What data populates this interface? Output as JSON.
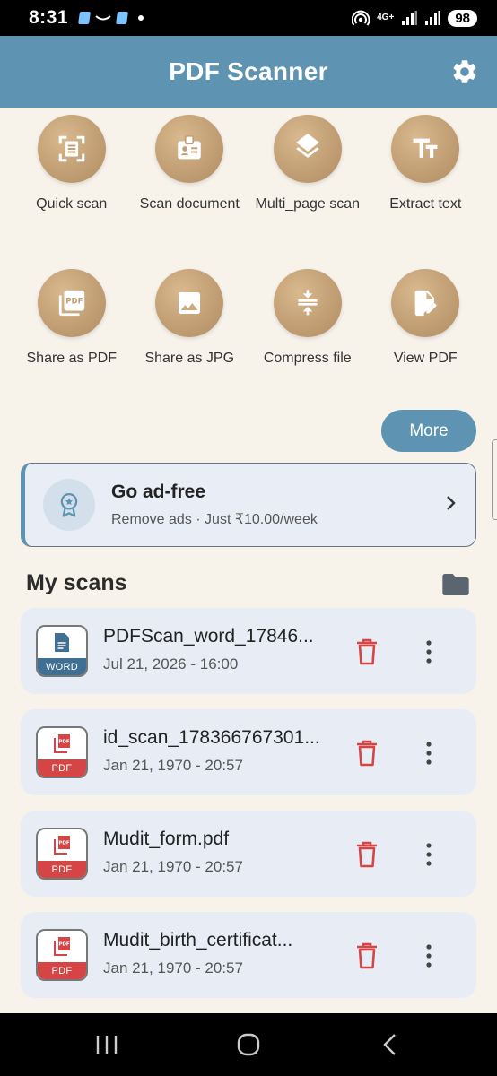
{
  "status_bar": {
    "time": "8:31",
    "network": "4G+",
    "battery": "98"
  },
  "app_bar": {
    "title": "PDF Scanner",
    "settings_icon": "gear-icon"
  },
  "tools": [
    {
      "label": "Quick scan",
      "icon": "scan-frame-icon"
    },
    {
      "label": "Scan document",
      "icon": "id-card-icon"
    },
    {
      "label": "Multi_page scan",
      "icon": "layers-icon"
    },
    {
      "label": "Extract text",
      "icon": "text-size-icon"
    },
    {
      "label": "Share as PDF",
      "icon": "pdf-stack-icon"
    },
    {
      "label": "Share as JPG",
      "icon": "image-icon"
    },
    {
      "label": "Compress file",
      "icon": "compress-icon"
    },
    {
      "label": "View PDF",
      "icon": "edit-document-icon"
    }
  ],
  "more_button": {
    "label": "More"
  },
  "ad_card": {
    "title": "Go ad-free",
    "subtitle": "Remove ads · Just ₹10.00/week",
    "icon": "badge-icon"
  },
  "my_scans": {
    "title": "My scans",
    "folder_icon": "folder-icon",
    "items": [
      {
        "name": "PDFScan_word_17846...",
        "date": "Jul 21, 2026 - 16:00",
        "type": "WORD"
      },
      {
        "name": "id_scan_178366767301...",
        "date": "Jan 21, 1970 - 20:57",
        "type": "PDF"
      },
      {
        "name": "Mudit_form.pdf",
        "date": "Jan 21, 1970 - 20:57",
        "type": "PDF"
      },
      {
        "name": "Mudit_birth_certificat...",
        "date": "Jan 21, 1970 - 20:57",
        "type": "PDF"
      }
    ]
  },
  "colors": {
    "app_bar": "#5e93b2",
    "tool_circle": "#c29f75",
    "delete": "#d64545",
    "background": "#f7f2ea"
  }
}
